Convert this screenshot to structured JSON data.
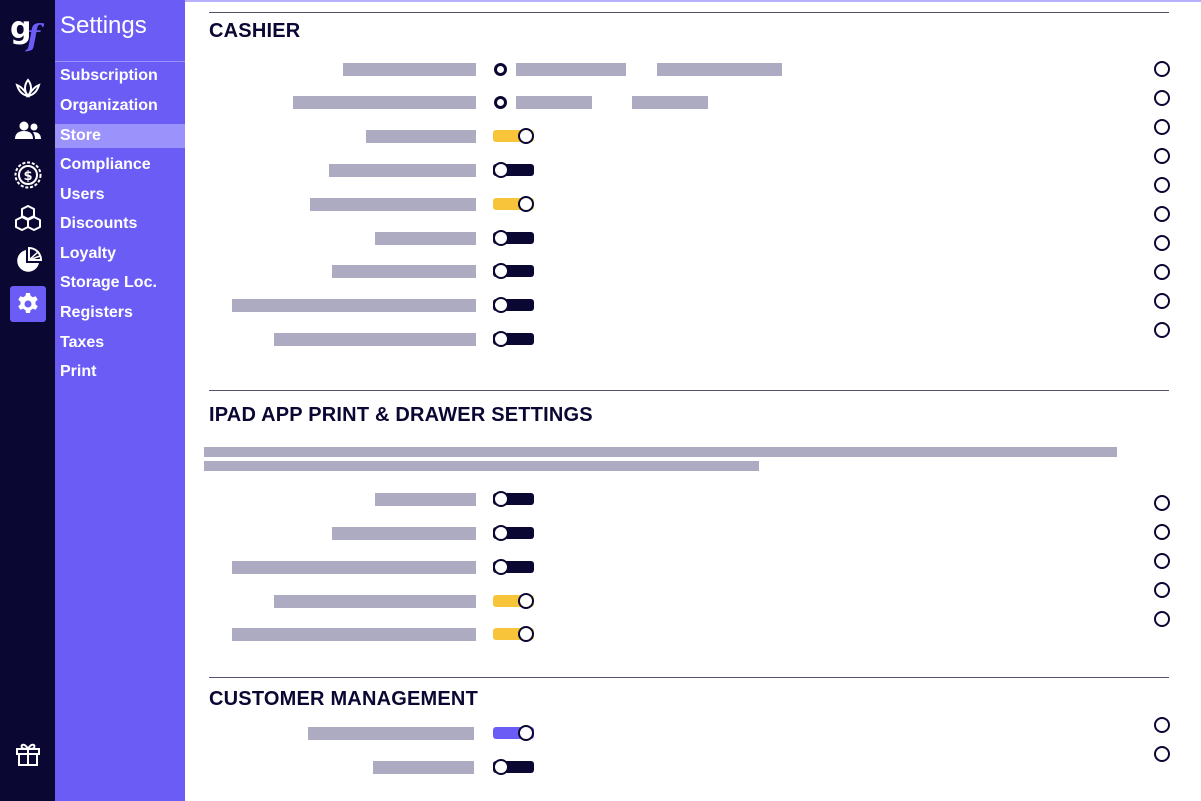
{
  "app": {
    "logo_text": "gf",
    "title": "Settings"
  },
  "rail": {
    "icons": [
      "leaf-icon",
      "users-icon",
      "compliance-seal-icon",
      "inventory-boxes-icon",
      "reports-pie-icon",
      "settings-gear-icon",
      "gift-icon"
    ],
    "active": "settings-gear-icon"
  },
  "nav": {
    "items": [
      {
        "label": "Subscription"
      },
      {
        "label": "Organization"
      },
      {
        "label": "Store",
        "active": true
      },
      {
        "label": "Compliance"
      },
      {
        "label": "Users"
      },
      {
        "label": "Discounts"
      },
      {
        "label": "Loyalty"
      },
      {
        "label": "Storage Loc."
      },
      {
        "label": "Registers"
      },
      {
        "label": "Taxes"
      },
      {
        "label": "Print"
      }
    ]
  },
  "sections": [
    {
      "title": "CASHIER",
      "settings": [
        {
          "control": "radio"
        },
        {
          "control": "radio"
        },
        {
          "control": "toggle",
          "enabled": true
        },
        {
          "control": "toggle",
          "enabled": false
        },
        {
          "control": "toggle",
          "enabled": true
        },
        {
          "control": "toggle",
          "enabled": false
        },
        {
          "control": "toggle",
          "enabled": false
        },
        {
          "control": "toggle",
          "enabled": false
        },
        {
          "control": "toggle",
          "enabled": false
        }
      ]
    },
    {
      "title": "IPAD APP PRINT & DRAWER SETTINGS",
      "settings": [
        {
          "control": "toggle",
          "enabled": false
        },
        {
          "control": "toggle",
          "enabled": false
        },
        {
          "control": "toggle",
          "enabled": false
        },
        {
          "control": "toggle",
          "enabled": true
        },
        {
          "control": "toggle",
          "enabled": true
        }
      ]
    },
    {
      "title": "CUSTOMER MANAGEMENT",
      "settings": [
        {
          "control": "toggle",
          "enabled": true
        },
        {
          "control": "toggle",
          "enabled": false
        }
      ]
    }
  ],
  "colors": {
    "rail_bg": "#0b0733",
    "nav_bg": "#6b5cf6",
    "nav_active_bg": "#9c92fb",
    "toggle_on": "#f8c43a",
    "toggle_on_accent": "#6b5cf6",
    "toggle_off": "#0b0733",
    "placeholder_bar": "#adabc2"
  }
}
